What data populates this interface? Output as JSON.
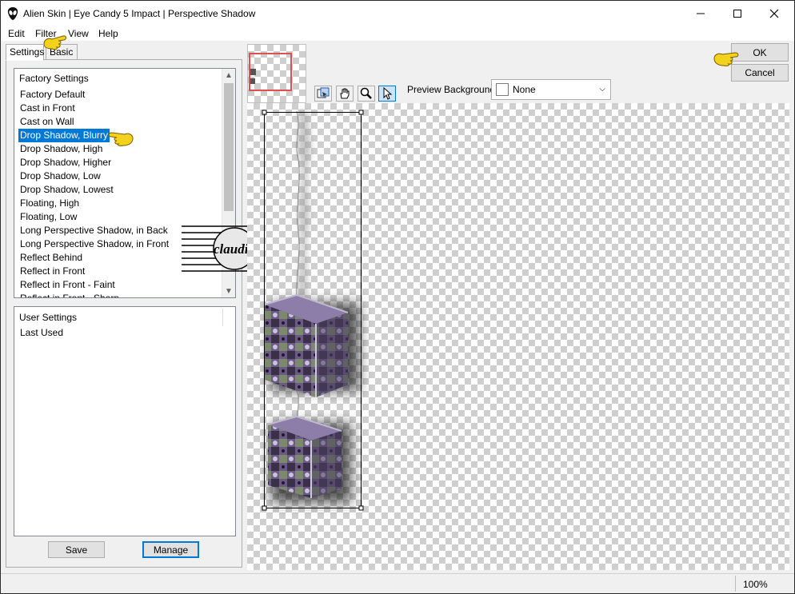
{
  "window": {
    "title": "Alien Skin | Eye Candy 5 Impact | Perspective Shadow"
  },
  "menu": [
    "Edit",
    "Filter",
    "View",
    "Help"
  ],
  "tabs": [
    "Settings",
    "Basic"
  ],
  "factory_settings": {
    "header": "Factory Settings",
    "items": [
      "Factory Default",
      "Cast in Front",
      "Cast on Wall",
      "Drop Shadow, Blurry",
      "Drop Shadow, High",
      "Drop Shadow, Higher",
      "Drop Shadow, Low",
      "Drop Shadow, Lowest",
      "Floating, High",
      "Floating, Low",
      "Long Perspective Shadow, in Back",
      "Long Perspective Shadow, in Front",
      "Reflect Behind",
      "Reflect in Front",
      "Reflect in Front - Faint",
      "Reflect in Front - Sharp"
    ],
    "selected": "Drop Shadow, Blurry"
  },
  "user_settings": {
    "header": "User Settings",
    "items": [
      "Last Used"
    ]
  },
  "buttons": {
    "save": "Save",
    "manage": "Manage",
    "ok": "OK",
    "cancel": "Cancel"
  },
  "toolbar": {
    "tools": [
      "navigate-preview-icon",
      "hand-pan-icon",
      "zoom-icon",
      "select-arrow-icon"
    ],
    "active_tool": "select-arrow-icon"
  },
  "preview_background": {
    "label": "Preview Background:",
    "value": "None"
  },
  "watermark": {
    "text": "claudia"
  },
  "status": {
    "zoom": "100%"
  },
  "colors": {
    "selection": "#0078d7",
    "pointer_hand": "#f2d21b",
    "cube_purple": "#6b5a86",
    "cube_green": "#7a8a6a"
  }
}
